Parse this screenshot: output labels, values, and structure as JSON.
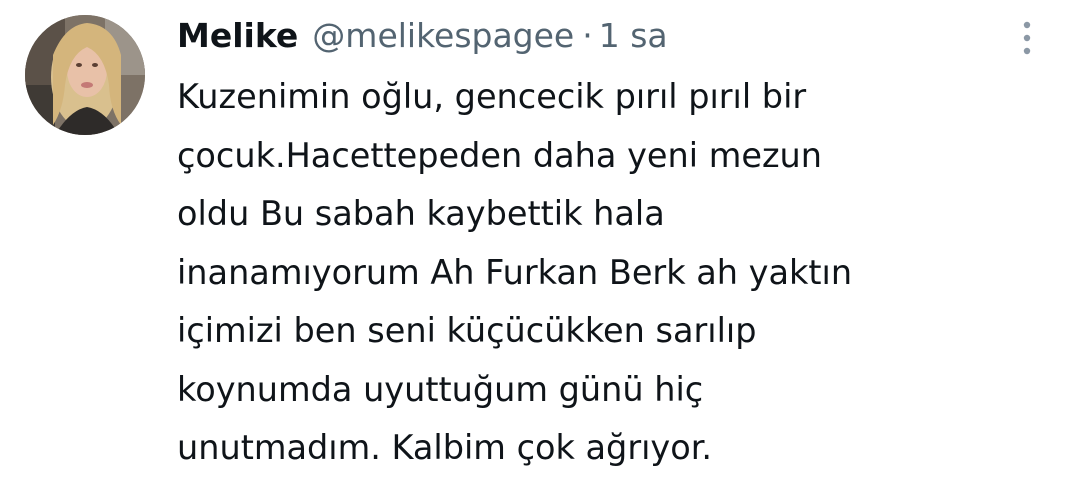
{
  "tweet": {
    "author_name": "Melike",
    "author_handle": "@melikespagee",
    "separator": "·",
    "time": "1 sa",
    "more_icon": "more-vertical-icon",
    "avatar_icon": "profile-photo",
    "text_lines": [
      "Kuzenimin oğlu, gencecik pırıl pırıl bir",
      "çocuk.Hacettepeden daha yeni mezun",
      "oldu Bu sabah kaybettik hala",
      "inanamıyorum Ah Furkan Berk ah yaktın",
      "içimizi ben seni küçücükken sarılıp",
      "koynumda uyuttuğum günü hiç",
      "unutmadım. Kalbim çok ağrıyor."
    ]
  },
  "colors": {
    "text_primary": "#0f1419",
    "text_secondary": "#536471",
    "background": "#ffffff"
  }
}
